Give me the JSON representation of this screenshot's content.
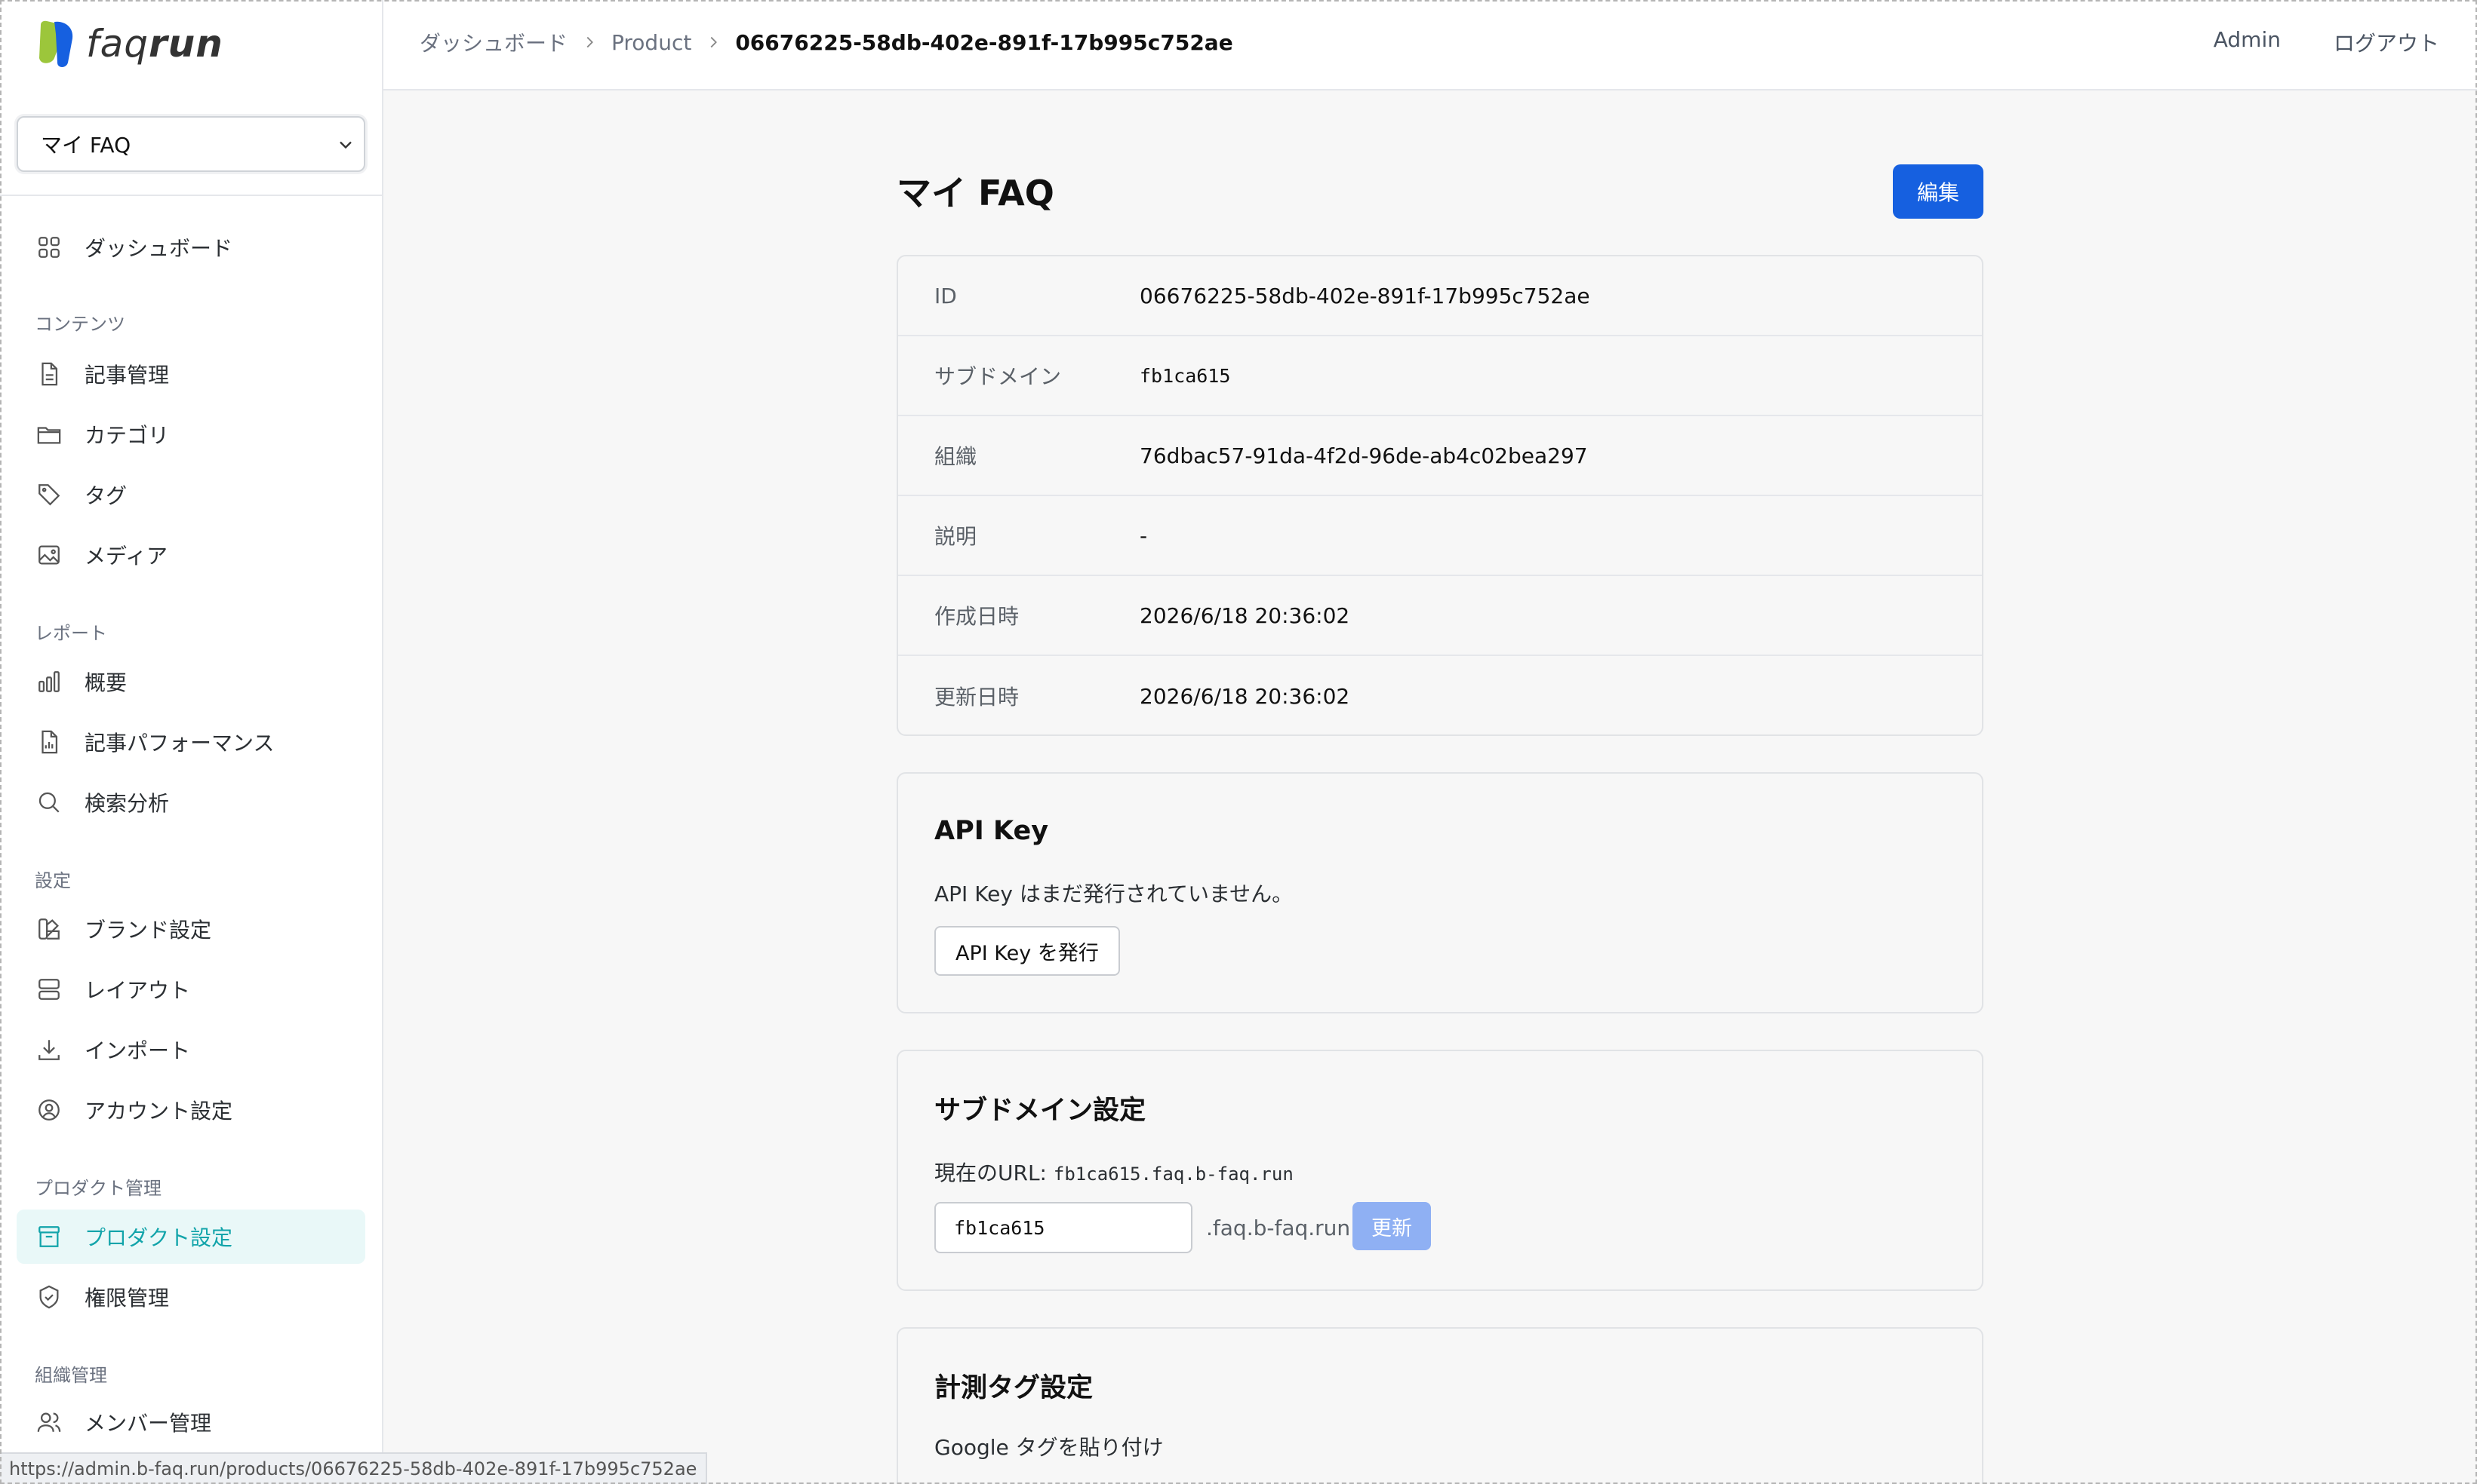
{
  "brand": {
    "name_light": "faq",
    "name_bold": "run",
    "accent": "#12a4aa",
    "logo_blue": "#1660e0",
    "logo_green": "#9cc63b"
  },
  "product_selector": {
    "value": "マイ FAQ"
  },
  "sidebar": {
    "top": [
      {
        "label": "ダッシュボード",
        "icon": "grid-icon"
      }
    ],
    "sections": [
      {
        "title": "コンテンツ",
        "items": [
          {
            "label": "記事管理",
            "icon": "document-icon"
          },
          {
            "label": "カテゴリ",
            "icon": "folder-icon"
          },
          {
            "label": "タグ",
            "icon": "tag-icon"
          },
          {
            "label": "メディア",
            "icon": "image-icon"
          }
        ]
      },
      {
        "title": "レポート",
        "items": [
          {
            "label": "概要",
            "icon": "bar-chart-icon"
          },
          {
            "label": "記事パフォーマンス",
            "icon": "document-chart-icon"
          },
          {
            "label": "検索分析",
            "icon": "search-icon"
          }
        ]
      },
      {
        "title": "設定",
        "items": [
          {
            "label": "ブランド設定",
            "icon": "palette-icon"
          },
          {
            "label": "レイアウト",
            "icon": "layout-icon"
          },
          {
            "label": "インポート",
            "icon": "download-icon"
          },
          {
            "label": "アカウント設定",
            "icon": "user-circle-icon"
          }
        ]
      },
      {
        "title": "プロダクト管理",
        "items": [
          {
            "label": "プロダクト設定",
            "icon": "archive-icon",
            "active": true
          },
          {
            "label": "権限管理",
            "icon": "shield-check-icon"
          }
        ]
      },
      {
        "title": "組織管理",
        "items": [
          {
            "label": "メンバー管理",
            "icon": "users-icon"
          }
        ]
      }
    ]
  },
  "breadcrumb": [
    "ダッシュボード",
    "Product",
    "06676225-58db-402e-891f-17b995c752ae"
  ],
  "topbar": {
    "user": "Admin",
    "logout": "ログアウト"
  },
  "page": {
    "title": "マイ FAQ",
    "edit_label": "編集"
  },
  "details": [
    {
      "key": "ID",
      "value": "06676225-58db-402e-891f-17b995c752ae",
      "mono": false
    },
    {
      "key": "サブドメイン",
      "value": "fb1ca615",
      "mono": true
    },
    {
      "key": "組織",
      "value": "76dbac57-91da-4f2d-96de-ab4c02bea297",
      "mono": false
    },
    {
      "key": "説明",
      "value": "-",
      "mono": false
    },
    {
      "key": "作成日時",
      "value": "2026/6/18 20:36:02",
      "mono": false
    },
    {
      "key": "更新日時",
      "value": "2026/6/18 20:36:02",
      "mono": false
    }
  ],
  "api_key": {
    "title": "API Key",
    "message": "API Key はまだ発行されていません。",
    "button": "API Key を発行"
  },
  "subdomain": {
    "title": "サブドメイン設定",
    "current_label": "現在のURL: ",
    "current_url": "fb1ca615.faq.b-faq.run",
    "input_value": "fb1ca615",
    "suffix": ".faq.b-faq.run",
    "update_label": "更新"
  },
  "tracking": {
    "title": "計測タグ設定",
    "hint": "Google タグを貼り付け"
  },
  "status_bar": {
    "url": "https://admin.b-faq.run/products/06676225-58db-402e-891f-17b995c752ae"
  }
}
